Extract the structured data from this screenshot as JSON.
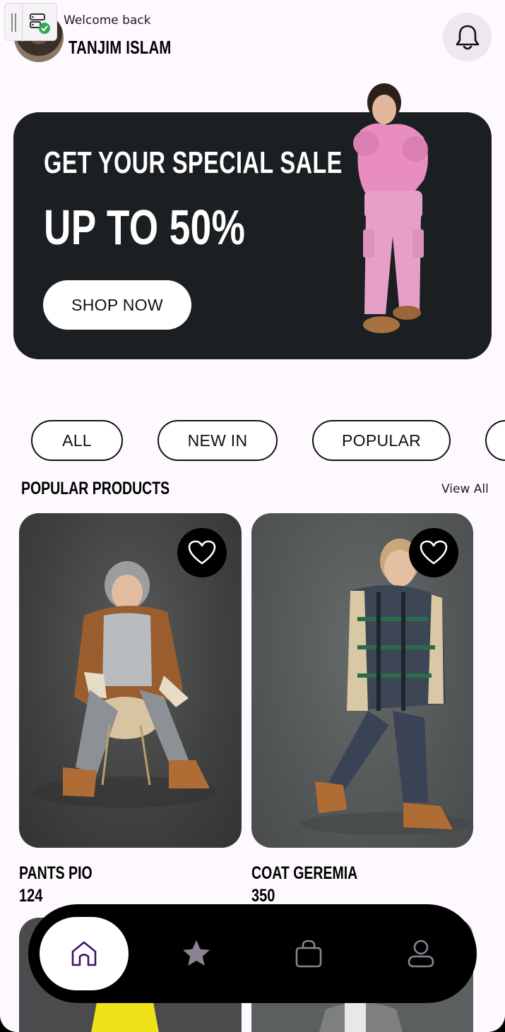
{
  "header": {
    "welcome": "Welcome back",
    "user_name": "TANJIM ISLAM"
  },
  "banner": {
    "title": "GET YOUR SPECIAL SALE",
    "discount": "UP TO 50%",
    "cta": "SHOP NOW"
  },
  "filters": [
    "ALL",
    "NEW IN",
    "POPULAR"
  ],
  "section": {
    "title": "POPULAR PRODUCTS",
    "view_all": "View All"
  },
  "products": [
    {
      "name": "PANTS PIO",
      "price": "124"
    },
    {
      "name": "COAT GEREMIA",
      "price": "350"
    }
  ],
  "nav": {
    "items": [
      {
        "icon": "home-icon",
        "active": true
      },
      {
        "icon": "star-icon",
        "active": false
      },
      {
        "icon": "bag-icon",
        "active": false
      },
      {
        "icon": "profile-icon",
        "active": false
      }
    ]
  },
  "colors": {
    "background": "#fdf9fe",
    "banner": "#1b1f21",
    "nav": "#000000",
    "nav_active_icon": "#3b1468",
    "nav_inactive_icon": "#8a8391"
  }
}
